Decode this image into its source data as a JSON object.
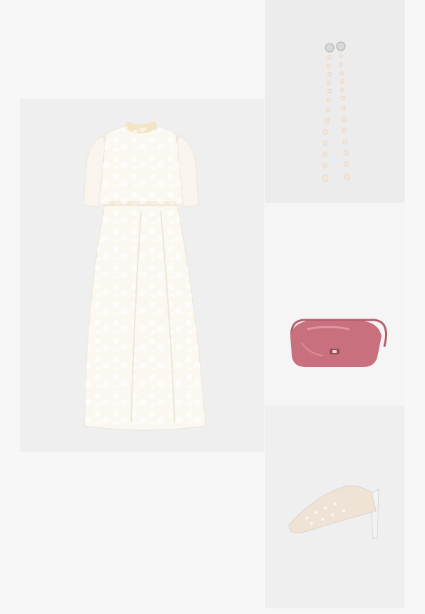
{
  "collage": {
    "background": "#f7f7f7",
    "items": [
      {
        "key": "dress",
        "name": "white-floral-midi-dress",
        "color": "#fbf8f1",
        "interactable": true
      },
      {
        "key": "earrings",
        "name": "pearl-drop-earrings",
        "color": "#f3e5d8",
        "interactable": true
      },
      {
        "key": "bag",
        "name": "pink-shoulder-bag",
        "color": "#c9707f",
        "interactable": true
      },
      {
        "key": "shoe",
        "name": "lace-slingback-pump",
        "color": "#efe3d6",
        "interactable": true
      }
    ]
  }
}
